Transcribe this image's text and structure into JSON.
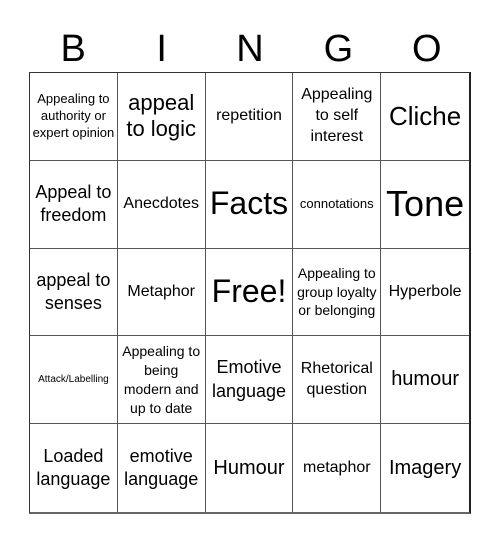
{
  "title_letters": [
    "B",
    "I",
    "N",
    "G",
    "O"
  ],
  "cells": [
    {
      "text": "Appealing to authority or expert opinion",
      "size": "s"
    },
    {
      "text": "appeal to logic",
      "size": "xl"
    },
    {
      "text": "repetition",
      "size": "m"
    },
    {
      "text": "Appealing to self interest",
      "size": "m"
    },
    {
      "text": "Cliche",
      "size": "xxl"
    },
    {
      "text": "Appeal to freedom",
      "size": "ml"
    },
    {
      "text": "Anecdotes",
      "size": "m"
    },
    {
      "text": "Facts",
      "size": "huge"
    },
    {
      "text": "connotations",
      "size": "xs2"
    },
    {
      "text": "Tone",
      "size": "giant"
    },
    {
      "text": "appeal to senses",
      "size": "ml"
    },
    {
      "text": "Metaphor",
      "size": "m"
    },
    {
      "text": "Free!",
      "size": "huge"
    },
    {
      "text": "Appealing to group loyalty or belonging",
      "size": "sm"
    },
    {
      "text": "Hyperbole",
      "size": "m"
    },
    {
      "text": "Attack/Labelling",
      "size": "xs"
    },
    {
      "text": "Appealing to being modern and up to date",
      "size": "sm"
    },
    {
      "text": "Emotive language",
      "size": "ml"
    },
    {
      "text": "Rhetorical question",
      "size": "m"
    },
    {
      "text": "humour",
      "size": "l"
    },
    {
      "text": "Loaded language",
      "size": "ml"
    },
    {
      "text": "emotive language",
      "size": "ml"
    },
    {
      "text": "Humour",
      "size": "l"
    },
    {
      "text": "metaphor",
      "size": "m"
    },
    {
      "text": "Imagery",
      "size": "l"
    }
  ],
  "free_space_index": 12
}
